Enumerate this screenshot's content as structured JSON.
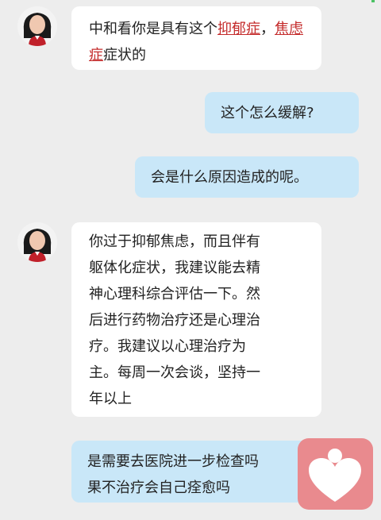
{
  "messages": [
    {
      "side": "left",
      "parts": [
        "中和看你是具有这个",
        "抑郁症",
        "，",
        "焦虑症",
        "症状的"
      ]
    },
    {
      "side": "right",
      "text": "这个怎么缓解?"
    },
    {
      "side": "right",
      "text": "会是什么原因造成的呢。"
    },
    {
      "side": "left",
      "lines": [
        "你过于抑郁焦虑，而且伴有",
        "躯体化症状，我建议能去精",
        "神心理科综合评估一下。然",
        "后进行药物治疗还是心理治",
        "疗。我建议以心理治疗为",
        "主。每周一次会谈，坚持一",
        "年以上"
      ]
    },
    {
      "side": "right",
      "lines": [
        "是需要去医院进一步检查吗",
        "果不治疗会自己痊愈吗"
      ]
    }
  ],
  "icons": {
    "avatar": "doctor-avatar",
    "badge": "heart-icon"
  },
  "colors": {
    "bg": "#ededed",
    "left_bubble": "#ffffff",
    "right_bubble": "#c9e7f8",
    "highlight": "#c42b2b",
    "badge": "#e98a8e"
  }
}
